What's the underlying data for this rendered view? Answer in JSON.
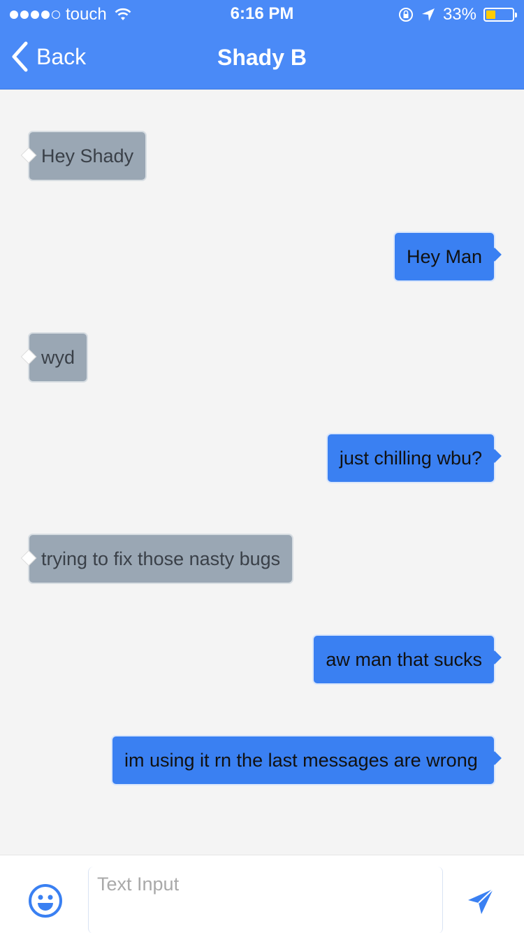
{
  "status_bar": {
    "carrier": "touch",
    "time": "6:16 PM",
    "battery_percent": "33%",
    "battery_level": 0.33,
    "icons": [
      "signal-dots",
      "wifi-icon",
      "orientation-lock-icon",
      "location-arrow-icon",
      "battery-icon"
    ]
  },
  "nav": {
    "back_label": "Back",
    "title": "Shady B"
  },
  "messages": [
    {
      "direction": "in",
      "text": "Hey Shady"
    },
    {
      "direction": "out",
      "text": "Hey Man"
    },
    {
      "direction": "in",
      "text": "wyd"
    },
    {
      "direction": "out",
      "text": "just chilling wbu?"
    },
    {
      "direction": "in",
      "text": "trying to fix those nasty bugs"
    },
    {
      "direction": "out",
      "text": "aw man that sucks"
    },
    {
      "direction": "out",
      "text": "im using it rn the last messages are wrong"
    }
  ],
  "composer": {
    "placeholder": "Text Input",
    "value": ""
  },
  "colors": {
    "header": "#4a8af7",
    "outgoing_bubble": "#3a80f2",
    "incoming_bubble": "#9aa7b4",
    "background": "#f4f4f4",
    "battery_fill": "#ffcc00"
  }
}
